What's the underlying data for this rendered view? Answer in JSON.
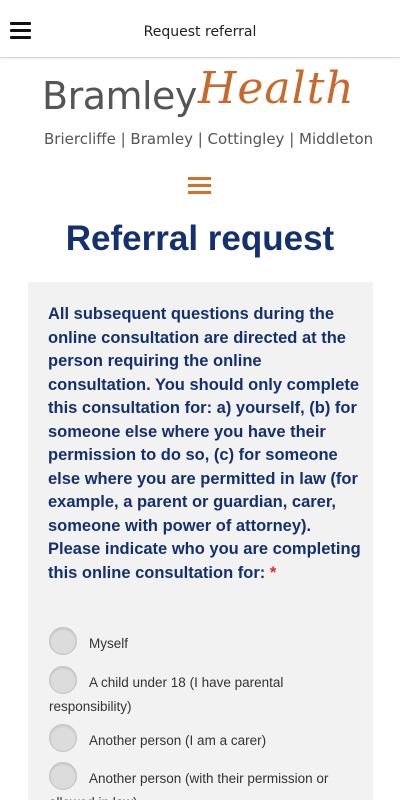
{
  "header": {
    "title": "Request referral",
    "menu_icon": "hamburger-menu-icon"
  },
  "logo": {
    "word1": "Bramley",
    "word2": "Health",
    "subtitle": "Briercliffe | Bramley | Cottingley | Middleton",
    "colors": {
      "gray": "#555555",
      "orange": "#c8682a"
    }
  },
  "nav": {
    "menu_icon": "orange-menu-icon",
    "color": "#d4702a"
  },
  "page": {
    "title": "Referral request",
    "title_color": "#14306e"
  },
  "form": {
    "question": "All subsequent questions during the online consultation are directed at the person requiring the online consultation. You should only complete this consultation for: a) yourself, (b) for someone else where you have their permission to do so, (c) for someone else where you are permitted in law (for example, a parent or guardian, carer, someone with power of attorney). Please indicate who you are completing this online consultation for:",
    "required_marker": "*",
    "options": [
      {
        "label": "Myself"
      },
      {
        "label": "A child under 18 (I have parental responsibility)"
      },
      {
        "label": "Another person (I am a carer)"
      },
      {
        "label": "Another person (with their permission or allowed in law)"
      }
    ]
  }
}
